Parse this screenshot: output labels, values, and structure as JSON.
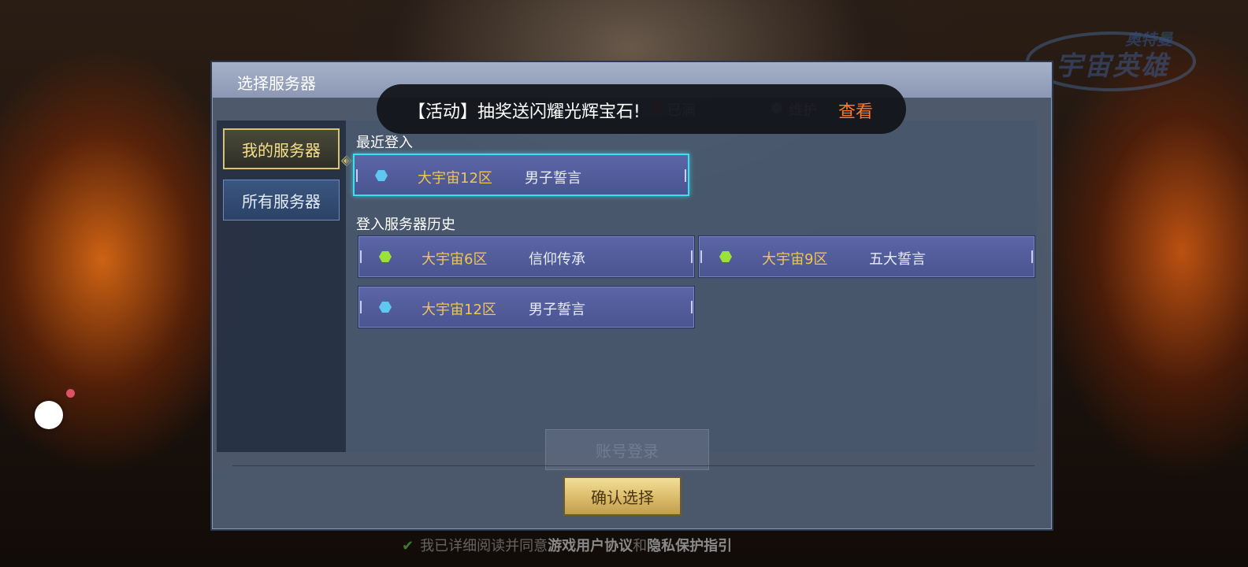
{
  "logo": {
    "sub": "奥特曼",
    "main": "宇宙英雄"
  },
  "dialog": {
    "title": "选择服务器",
    "legend": [
      {
        "label": "已满",
        "color": "#c0403a"
      },
      {
        "label": "维护",
        "color": "#9aa0aa"
      }
    ]
  },
  "sidebar": {
    "my_servers": "我的服务器",
    "all_servers": "所有服务器"
  },
  "recent": {
    "title": "最近登入",
    "server": {
      "zone": "大宇宙12区",
      "name": "男子誓言",
      "status_color": "#5ec8f0"
    }
  },
  "history": {
    "title": "登入服务器历史",
    "servers": [
      {
        "zone": "大宇宙6区",
        "name": "信仰传承",
        "status_color": "#9ee03a"
      },
      {
        "zone": "大宇宙9区",
        "name": "五大誓言",
        "status_color": "#9ee03a"
      },
      {
        "zone": "大宇宙12区",
        "name": "男子誓言",
        "status_color": "#5ec8f0"
      }
    ]
  },
  "ghost_login": "账号登录",
  "confirm_button": "确认选择",
  "toast": {
    "text": "【活动】抽奖送闪耀光辉宝石!",
    "link": "查看"
  },
  "agreement": {
    "prefix": "我已详细阅读并同意",
    "link1": "游戏用户协议",
    "middle": "和",
    "link2": "隐私保护指引"
  }
}
